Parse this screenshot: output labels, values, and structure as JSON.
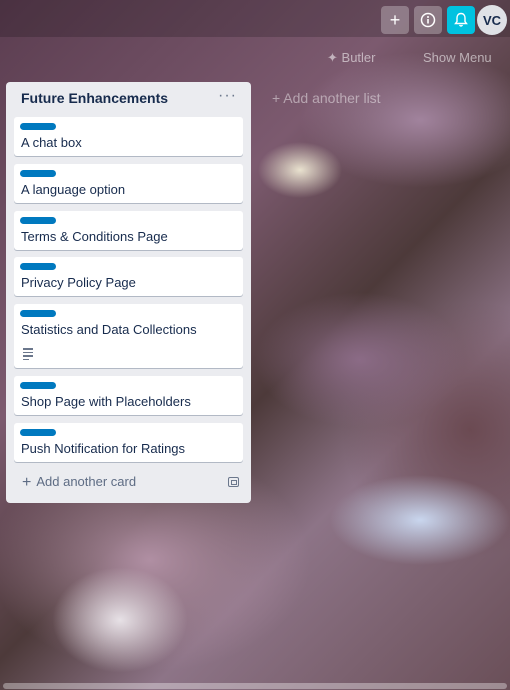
{
  "header": {
    "add_icon": "plus-icon",
    "info_icon": "info-icon",
    "notify_icon": "bell-icon",
    "avatar_initials": "VC",
    "notify_color": "#00c2e0"
  },
  "board": {
    "butler_label": "Butler",
    "show_menu_label": "Show Menu",
    "add_list_label": "+ Add another list"
  },
  "list": {
    "title": "Future Enhancements",
    "menu_label": "···",
    "label_color": "#0079bf",
    "cards": [
      {
        "title": "A chat box"
      },
      {
        "title": "A language option"
      },
      {
        "title": "Terms & Conditions Page"
      },
      {
        "title": "Privacy Policy Page"
      },
      {
        "title": "Statistics and Data Collections",
        "has_description": true
      },
      {
        "title": "Shop Page with Placeholders"
      },
      {
        "title": "Push Notification for Ratings"
      }
    ],
    "add_card_label": "Add another card"
  }
}
